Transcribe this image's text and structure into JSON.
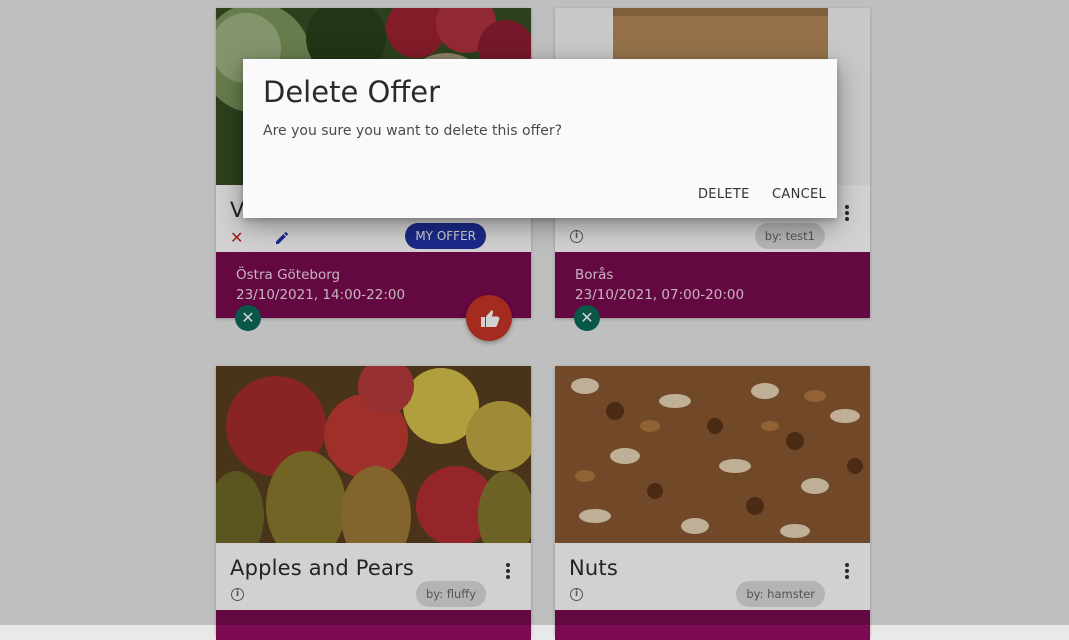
{
  "dialog": {
    "title": "Delete Offer",
    "message": "Are you sure you want to delete this offer?",
    "delete_label": "DELETE",
    "cancel_label": "CANCEL"
  },
  "cards": [
    {
      "title": "Vegetables",
      "title_visible": "V",
      "chip": "MY OFFER",
      "location": "Östra Göteborg",
      "datetime": "23/10/2021, 14:00-22:00",
      "image": "vegetables-image"
    },
    {
      "title": "",
      "chip": "by: test1",
      "location": "Borås",
      "datetime": "23/10/2021, 07:00-20:00",
      "image": "cardboard-box-image"
    },
    {
      "title": "Apples and Pears",
      "chip": "by: fluffy",
      "image": "apples-pears-image"
    },
    {
      "title": "Nuts",
      "chip": "by: hamster",
      "image": "nuts-image"
    }
  ],
  "icons": {
    "delete": "close-icon",
    "edit": "pencil-icon",
    "like": "thumb-up-icon",
    "info": "info-icon",
    "more": "more-vert-icon",
    "dismiss": "close-icon"
  },
  "colors": {
    "band": "#7b0a51",
    "chip_mine": "#2233a8",
    "like_fab": "#c73528",
    "close_fab": "#0b6b5a"
  }
}
